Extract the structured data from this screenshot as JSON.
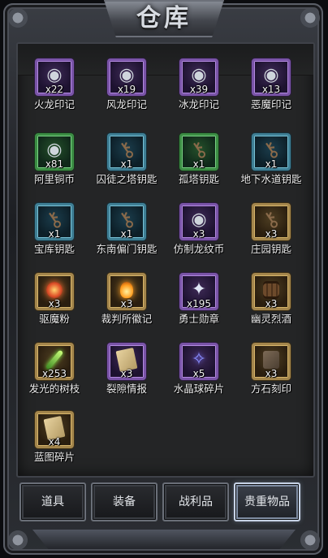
{
  "window": {
    "title": "仓库"
  },
  "items": [
    {
      "name": "火龙印记",
      "qty": "x22",
      "frame": "purple",
      "icon": "coin-icon",
      "glyph": "◉"
    },
    {
      "name": "风龙印记",
      "qty": "x19",
      "frame": "purple",
      "icon": "coin-icon",
      "glyph": "◉"
    },
    {
      "name": "冰龙印记",
      "qty": "x39",
      "frame": "purple",
      "icon": "coin-icon",
      "glyph": "◉"
    },
    {
      "name": "恶魔印记",
      "qty": "x13",
      "frame": "purple",
      "icon": "coin-icon",
      "glyph": "◉"
    },
    {
      "name": "阿里铜币",
      "qty": "x81",
      "frame": "green",
      "icon": "coin-icon",
      "glyph": "◉"
    },
    {
      "name": "囚徒之塔钥匙",
      "qty": "x1",
      "frame": "blue",
      "icon": "key-icon",
      "glyph": "⚷"
    },
    {
      "name": "孤塔钥匙",
      "qty": "x1",
      "frame": "green",
      "icon": "key-icon",
      "glyph": "⚷"
    },
    {
      "name": "地下水道钥匙",
      "qty": "x1",
      "frame": "blue",
      "icon": "key-icon",
      "glyph": "⚷"
    },
    {
      "name": "宝库钥匙",
      "qty": "x1",
      "frame": "blue",
      "icon": "key-icon",
      "glyph": "⚷"
    },
    {
      "name": "东南偏门钥匙",
      "qty": "x1",
      "frame": "blue",
      "icon": "key-icon",
      "glyph": "⚷"
    },
    {
      "name": "仿制龙纹币",
      "qty": "x3",
      "frame": "purple",
      "icon": "coin-icon",
      "glyph": "◉"
    },
    {
      "name": "庄园钥匙",
      "qty": "x3",
      "frame": "brown",
      "icon": "key-icon",
      "glyph": "⚷"
    },
    {
      "name": "驱魔粉",
      "qty": "x3",
      "frame": "brown",
      "icon": "red-orb-icon",
      "glyph": ""
    },
    {
      "name": "裁判所徽记",
      "qty": "x3",
      "frame": "brown",
      "icon": "flame-badge-icon",
      "glyph": ""
    },
    {
      "name": "勇士勋章",
      "qty": "x195",
      "frame": "purple",
      "icon": "medal-icon",
      "glyph": "✦"
    },
    {
      "name": "幽灵烈酒",
      "qty": "x3",
      "frame": "brown",
      "icon": "barrel-icon",
      "glyph": ""
    },
    {
      "name": "发光的树枝",
      "qty": "x253",
      "frame": "brown",
      "icon": "glowing-branch-icon",
      "glyph": ""
    },
    {
      "name": "裂隙情报",
      "qty": "x3",
      "frame": "purple",
      "icon": "scroll-icon",
      "glyph": ""
    },
    {
      "name": "水晶球碎片",
      "qty": "x5",
      "frame": "purple",
      "icon": "crystal-shard-icon",
      "glyph": "✧"
    },
    {
      "name": "方石刻印",
      "qty": "x3",
      "frame": "brown",
      "icon": "stone-tablet-icon",
      "glyph": ""
    },
    {
      "name": "蓝图碎片",
      "qty": "x4",
      "frame": "brown",
      "icon": "scroll-icon",
      "glyph": ""
    }
  ],
  "tabs": [
    {
      "label": "道具",
      "active": false
    },
    {
      "label": "装备",
      "active": false
    },
    {
      "label": "战利品",
      "active": false
    },
    {
      "label": "贵重物品",
      "active": true
    }
  ]
}
